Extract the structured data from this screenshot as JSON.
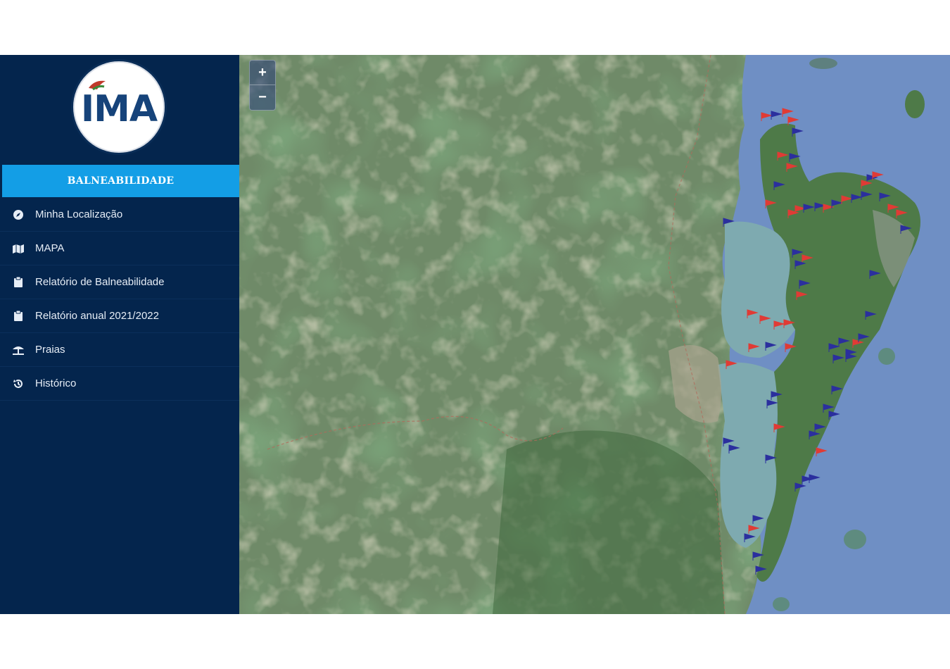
{
  "sidebar": {
    "logo_text": "IMA",
    "active_item": "BALNEABILIDADE",
    "items": [
      {
        "label": "Minha Localização",
        "icon": "compass-icon"
      },
      {
        "label": "MAPA",
        "icon": "map-icon"
      },
      {
        "label": "Relatório de Balneabilidade",
        "icon": "clipboard-icon"
      },
      {
        "label": "Relatório anual 2021/2022",
        "icon": "clipboard-icon"
      },
      {
        "label": "Praias",
        "icon": "beach-umbrella-icon"
      },
      {
        "label": "Histórico",
        "icon": "history-icon"
      }
    ]
  },
  "map": {
    "zoom_in_label": "+",
    "zoom_out_label": "−",
    "flag_colors": {
      "proper": "#2b2f9e",
      "improper": "#e03b35"
    }
  },
  "colors": {
    "sidebar_bg": "#04254d",
    "active_bg": "#139ee6"
  }
}
